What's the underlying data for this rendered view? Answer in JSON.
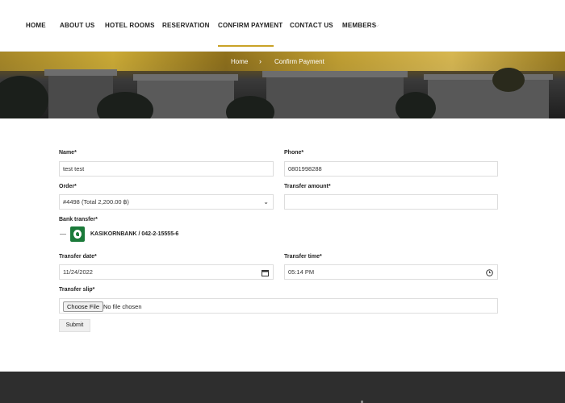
{
  "nav": {
    "items": [
      {
        "label": "HOME"
      },
      {
        "label": "ABOUT US"
      },
      {
        "label": "HOTEL ROOMS"
      },
      {
        "label": "RESERVATION"
      },
      {
        "label": "CONFIRM PAYMENT"
      },
      {
        "label": "CONTACT US"
      },
      {
        "label": "MEMBERS"
      }
    ],
    "active": "CONFIRM PAYMENT",
    "accent_color": "#c9a227"
  },
  "breadcrumb": {
    "home": "Home",
    "separator": "›",
    "current": "Confirm Payment"
  },
  "form": {
    "name": {
      "label": "Name*",
      "value": "test test"
    },
    "phone": {
      "label": "Phone*",
      "value": "0801998288"
    },
    "order": {
      "label": "Order*",
      "value": "#4498 (Total 2,200.00 ฿)"
    },
    "transfer_amount": {
      "label": "Transfer amount*",
      "value": ""
    },
    "bank_transfer": {
      "label": "Bank transfer*",
      "bank": "KASIKORNBANK / 042-2-15555-6"
    },
    "transfer_date": {
      "label": "Transfer date*",
      "value": "11/24/2022"
    },
    "transfer_time": {
      "label": "Transfer time*",
      "value": "05:14 PM"
    },
    "transfer_slip": {
      "label": "Transfer slip*",
      "button": "Choose File",
      "status": "No file chosen"
    },
    "submit": "Submit"
  },
  "icons": {
    "members_dropdown": "chevron-down-icon",
    "order_dropdown": "chevron-down-icon",
    "date_picker": "calendar-icon",
    "time_picker": "clock-icon",
    "bank_logo": "kasikornbank-logo"
  }
}
